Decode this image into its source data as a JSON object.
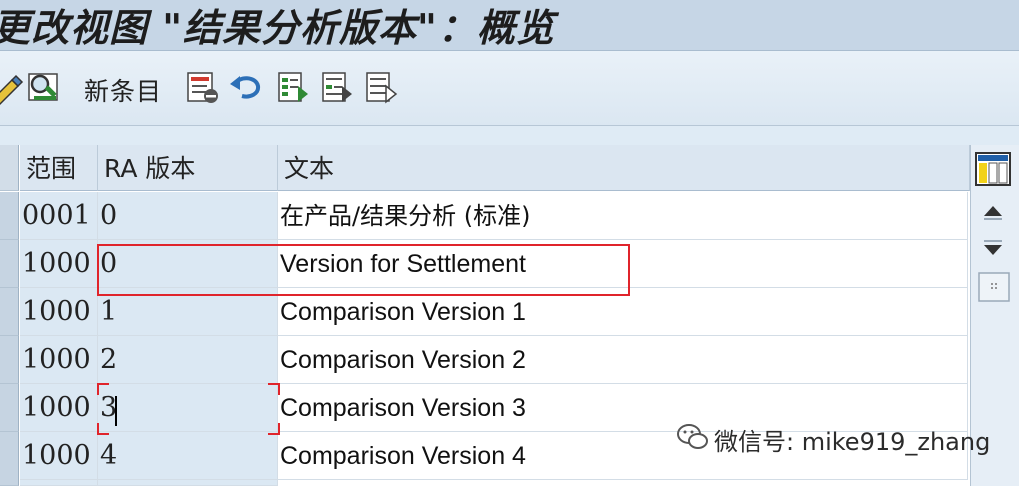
{
  "window": {
    "title": "更改视图 \"结果分析版本\"：概览"
  },
  "toolbar": {
    "icons": [
      "pencil-icon",
      "glasses-icon",
      "new-entries-text",
      "delete-icon",
      "undo-icon",
      "select-all-icon",
      "select-block-icon",
      "deselect-all-icon"
    ],
    "new_entries_label": "新条目"
  },
  "table": {
    "columns": [
      "范围",
      "RA 版本",
      "文本"
    ],
    "rows": [
      {
        "area": "0001",
        "version": "0",
        "text": "在产品/结果分析 (标准)"
      },
      {
        "area": "1000",
        "version": "0",
        "text": "Version for Settlement"
      },
      {
        "area": "1000",
        "version": "1",
        "text": "Comparison Version 1"
      },
      {
        "area": "1000",
        "version": "2",
        "text": "Comparison Version 2"
      },
      {
        "area": "1000",
        "version": "3",
        "text": "Comparison Version 3"
      },
      {
        "area": "1000",
        "version": "4",
        "text": "Comparison Version 4"
      }
    ]
  },
  "watermark": {
    "text": "微信号: mike919_zhang"
  },
  "colors": {
    "highlight": "#e0242b",
    "key_column_bg": "#dbe8f3",
    "header_bg": "#dbe6f1"
  }
}
